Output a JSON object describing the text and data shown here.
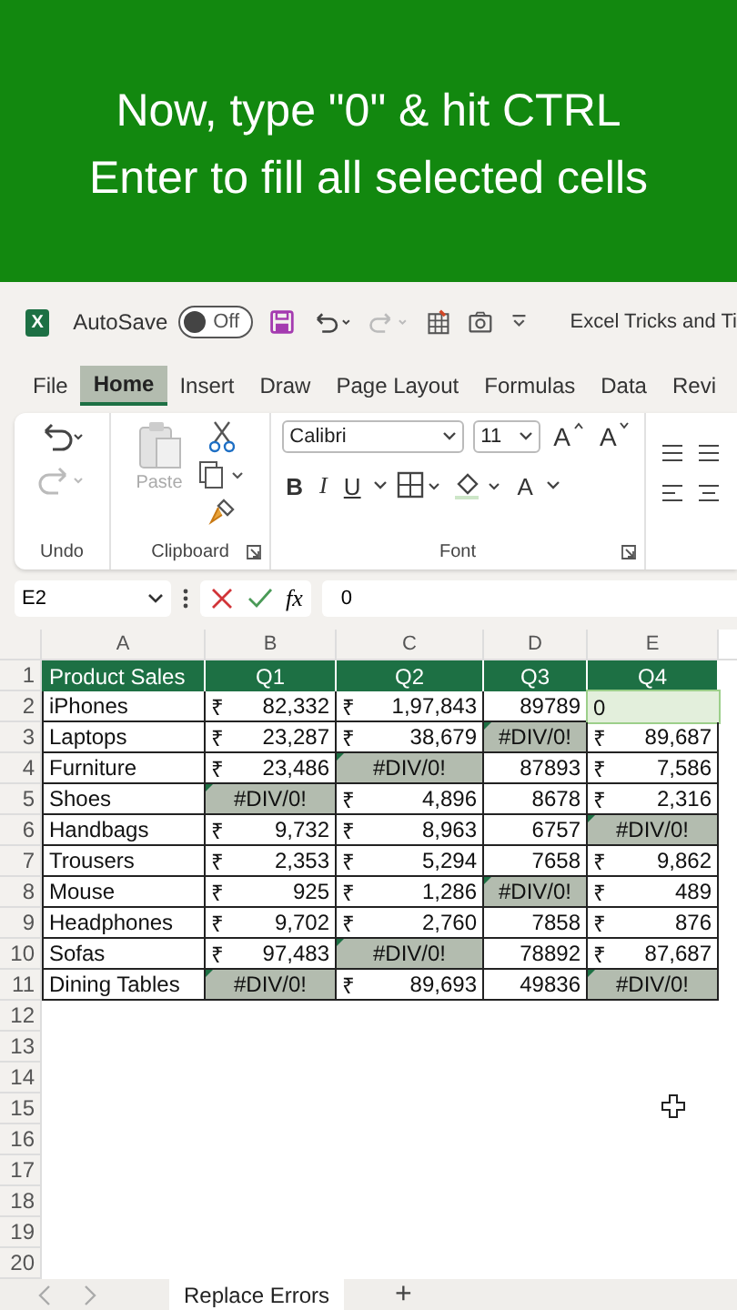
{
  "banner": {
    "lines": [
      "Now, type \"0\" & hit CTRL",
      "Enter to fill all selected cells"
    ]
  },
  "title_bar": {
    "logo_letter": "X",
    "autosave_label": "AutoSave",
    "autosave": {
      "on": false,
      "label": "Off"
    },
    "document_title": "Excel Tricks and Ti"
  },
  "menu_tabs": [
    {
      "label": "File",
      "selected": false
    },
    {
      "label": "Home",
      "selected": true
    },
    {
      "label": "Insert",
      "selected": false
    },
    {
      "label": "Draw",
      "selected": false
    },
    {
      "label": "Page Layout",
      "selected": false
    },
    {
      "label": "Formulas",
      "selected": false
    },
    {
      "label": "Data",
      "selected": false
    },
    {
      "label": "Revi",
      "selected": false
    }
  ],
  "ribbon": {
    "undo_group": "Undo",
    "clipboard_group": "Clipboard",
    "paste_label": "Paste",
    "font_group": "Font",
    "font_name": "Calibri",
    "font_size": "11",
    "grow_label": "A",
    "shrink_label": "A",
    "bold_label": "B",
    "italic_label": "I",
    "underline_label": "U",
    "font_color_label": "A"
  },
  "formula_bar": {
    "name_box": "E2",
    "fx_label": "fx",
    "value": "0"
  },
  "sheet": {
    "columns": [
      "A",
      "B",
      "C",
      "D",
      "E"
    ],
    "header_row": {
      "number": "1",
      "cells": [
        "Product Sales",
        "Q1",
        "Q2",
        "Q3",
        "Q4"
      ]
    },
    "rows": [
      {
        "number": "2",
        "cells": [
          {
            "kind": "text",
            "value": "iPhones",
            "selected": false
          },
          {
            "kind": "currency",
            "symbol": "₹",
            "value": "82,332",
            "selected": false
          },
          {
            "kind": "currency",
            "symbol": "₹",
            "value": "1,97,843",
            "selected": false
          },
          {
            "kind": "number",
            "value": "89789",
            "selected": false
          },
          {
            "kind": "editing",
            "value": "0",
            "selected": true
          }
        ]
      },
      {
        "number": "3",
        "cells": [
          {
            "kind": "text",
            "value": "Laptops",
            "selected": false
          },
          {
            "kind": "currency",
            "symbol": "₹",
            "value": "23,287",
            "selected": false
          },
          {
            "kind": "currency",
            "symbol": "₹",
            "value": "38,679",
            "selected": false
          },
          {
            "kind": "error",
            "value": "#DIV/0!",
            "selected": true
          },
          {
            "kind": "currency",
            "symbol": "₹",
            "value": "89,687",
            "selected": false
          }
        ]
      },
      {
        "number": "4",
        "cells": [
          {
            "kind": "text",
            "value": "Furniture",
            "selected": false
          },
          {
            "kind": "currency",
            "symbol": "₹",
            "value": "23,486",
            "selected": false
          },
          {
            "kind": "error",
            "value": "#DIV/0!",
            "selected": true
          },
          {
            "kind": "number",
            "value": "87893",
            "selected": false
          },
          {
            "kind": "currency",
            "symbol": "₹",
            "value": "7,586",
            "selected": false
          }
        ]
      },
      {
        "number": "5",
        "cells": [
          {
            "kind": "text",
            "value": "Shoes",
            "selected": false
          },
          {
            "kind": "error",
            "value": "#DIV/0!",
            "selected": true
          },
          {
            "kind": "currency",
            "symbol": "₹",
            "value": "4,896",
            "selected": false
          },
          {
            "kind": "number",
            "value": "8678",
            "selected": false
          },
          {
            "kind": "currency",
            "symbol": "₹",
            "value": "2,316",
            "selected": false
          }
        ]
      },
      {
        "number": "6",
        "cells": [
          {
            "kind": "text",
            "value": "Handbags",
            "selected": false
          },
          {
            "kind": "currency",
            "symbol": "₹",
            "value": "9,732",
            "selected": false
          },
          {
            "kind": "currency",
            "symbol": "₹",
            "value": "8,963",
            "selected": false
          },
          {
            "kind": "number",
            "value": "6757",
            "selected": false
          },
          {
            "kind": "error",
            "value": "#DIV/0!",
            "selected": true
          }
        ]
      },
      {
        "number": "7",
        "cells": [
          {
            "kind": "text",
            "value": "Trousers",
            "selected": false
          },
          {
            "kind": "currency",
            "symbol": "₹",
            "value": "2,353",
            "selected": false
          },
          {
            "kind": "currency",
            "symbol": "₹",
            "value": "5,294",
            "selected": false
          },
          {
            "kind": "number",
            "value": "7658",
            "selected": false
          },
          {
            "kind": "currency",
            "symbol": "₹",
            "value": "9,862",
            "selected": false
          }
        ]
      },
      {
        "number": "8",
        "cells": [
          {
            "kind": "text",
            "value": "Mouse",
            "selected": false
          },
          {
            "kind": "currency",
            "symbol": "₹",
            "value": "925",
            "selected": false
          },
          {
            "kind": "currency",
            "symbol": "₹",
            "value": "1,286",
            "selected": false
          },
          {
            "kind": "error",
            "value": "#DIV/0!",
            "selected": true
          },
          {
            "kind": "currency",
            "symbol": "₹",
            "value": "489",
            "selected": false
          }
        ]
      },
      {
        "number": "9",
        "cells": [
          {
            "kind": "text",
            "value": "Headphones",
            "selected": false
          },
          {
            "kind": "currency",
            "symbol": "₹",
            "value": "9,702",
            "selected": false
          },
          {
            "kind": "currency",
            "symbol": "₹",
            "value": "2,760",
            "selected": false
          },
          {
            "kind": "number",
            "value": "7858",
            "selected": false
          },
          {
            "kind": "currency",
            "symbol": "₹",
            "value": "876",
            "selected": false
          }
        ]
      },
      {
        "number": "10",
        "cells": [
          {
            "kind": "text",
            "value": "Sofas",
            "selected": false
          },
          {
            "kind": "currency",
            "symbol": "₹",
            "value": "97,483",
            "selected": false
          },
          {
            "kind": "error",
            "value": "#DIV/0!",
            "selected": true
          },
          {
            "kind": "number",
            "value": "78892",
            "selected": false
          },
          {
            "kind": "currency",
            "symbol": "₹",
            "value": "87,687",
            "selected": false
          }
        ]
      },
      {
        "number": "11",
        "cells": [
          {
            "kind": "text",
            "value": "Dining Tables",
            "selected": false
          },
          {
            "kind": "error",
            "value": "#DIV/0!",
            "selected": true
          },
          {
            "kind": "currency",
            "symbol": "₹",
            "value": "89,693",
            "selected": false
          },
          {
            "kind": "number",
            "value": "49836",
            "selected": false
          },
          {
            "kind": "error",
            "value": "#DIV/0!",
            "selected": true
          }
        ]
      }
    ],
    "empty_rows": [
      "12",
      "13",
      "14",
      "15",
      "16",
      "17",
      "18",
      "19",
      "20"
    ]
  },
  "sheet_tabs": [
    {
      "label": "Replace Errors",
      "selected": true
    }
  ],
  "add_sheet": "+"
}
